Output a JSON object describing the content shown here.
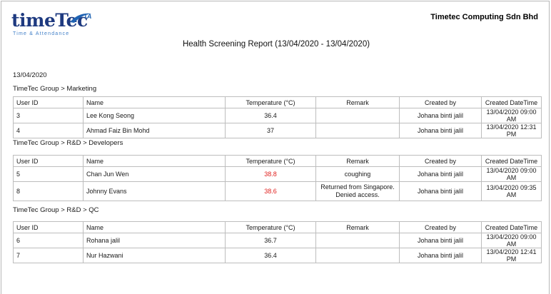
{
  "header": {
    "logo_main": "timeTec",
    "logo_badge": "TA",
    "logo_tagline": "Time & Attendance",
    "company": "Timetec Computing Sdn Bhd",
    "title": "Health Screening Report (13/04/2020 - 13/04/2020)"
  },
  "report_date": "13/04/2020",
  "columns": [
    "User ID",
    "Name",
    "Temperature (°C)",
    "Remark",
    "Created by",
    "Created DateTime"
  ],
  "colors": {
    "high_temperature": "#e0201e",
    "logo_blue": "#1e3a80"
  },
  "groups": [
    {
      "path": "TimeTec Group > Marketing",
      "rows": [
        {
          "user_id": "3",
          "name": "Lee Kong Seong",
          "temperature": "36.4",
          "remark_1": "",
          "remark_2": "",
          "created_by": "Johana binti jalil",
          "created_datetime": "13/04/2020 09:00 AM",
          "high": false
        },
        {
          "user_id": "4",
          "name": "Ahmad Faiz Bin Mohd",
          "temperature": "37",
          "remark_1": "",
          "remark_2": "",
          "created_by": "Johana binti jalil",
          "created_datetime": "13/04/2020 12:31 PM",
          "high": false
        }
      ]
    },
    {
      "path": "TimeTec Group > R&D > Developers",
      "rows": [
        {
          "user_id": "5",
          "name": "Chan Jun Wen",
          "temperature": "38.8",
          "remark_1": "coughing",
          "remark_2": "",
          "created_by": "Johana binti jalil",
          "created_datetime": "13/04/2020 09:00 AM",
          "high": true
        },
        {
          "user_id": "8",
          "name": "Johnny Evans",
          "temperature": "38.6",
          "remark_1": "Returned from Singapore.",
          "remark_2": "Denied access.",
          "created_by": "Johana binti jalil",
          "created_datetime": "13/04/2020 09:35 AM",
          "high": true
        }
      ]
    },
    {
      "path": "TimeTec Group > R&D > QC",
      "rows": [
        {
          "user_id": "6",
          "name": "Rohana jalil",
          "temperature": "36.7",
          "remark_1": "",
          "remark_2": "",
          "created_by": "Johana binti jalil",
          "created_datetime": "13/04/2020 09:00 AM",
          "high": false
        },
        {
          "user_id": "7",
          "name": "Nur Hazwani",
          "temperature": "36.4",
          "remark_1": "",
          "remark_2": "",
          "created_by": "Johana binti jalil",
          "created_datetime": "13/04/2020 12:41 PM",
          "high": false
        }
      ]
    }
  ]
}
